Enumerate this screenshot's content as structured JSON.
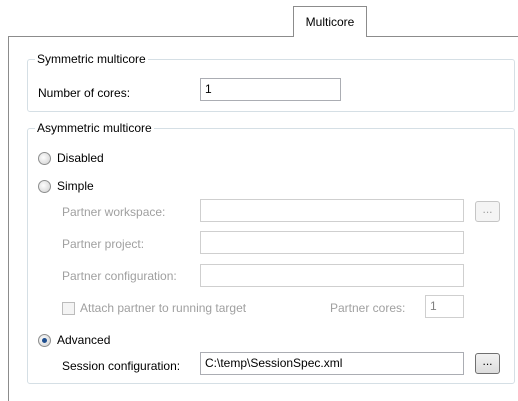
{
  "tab": {
    "label": "Multicore"
  },
  "symmetric": {
    "title": "Symmetric multicore",
    "cores_label": "Number of cores:",
    "cores_value": "1"
  },
  "asymmetric": {
    "title": "Asymmetric multicore",
    "mode": {
      "disabled_label": "Disabled",
      "simple_label": "Simple",
      "advanced_label": "Advanced",
      "selected": "Advanced"
    },
    "simple": {
      "partner_workspace_label": "Partner workspace:",
      "partner_workspace_value": "",
      "partner_project_label": "Partner project:",
      "partner_project_value": "",
      "partner_configuration_label": "Partner configuration:",
      "partner_configuration_value": "",
      "attach_label": "Attach partner to running target",
      "attach_checked": false,
      "partner_cores_label": "Partner cores:",
      "partner_cores_value": "1",
      "browse_label": "..."
    },
    "advanced": {
      "session_config_label": "Session configuration:",
      "session_config_value": "C:\\temp\\SessionSpec.xml",
      "browse_label": "..."
    }
  }
}
